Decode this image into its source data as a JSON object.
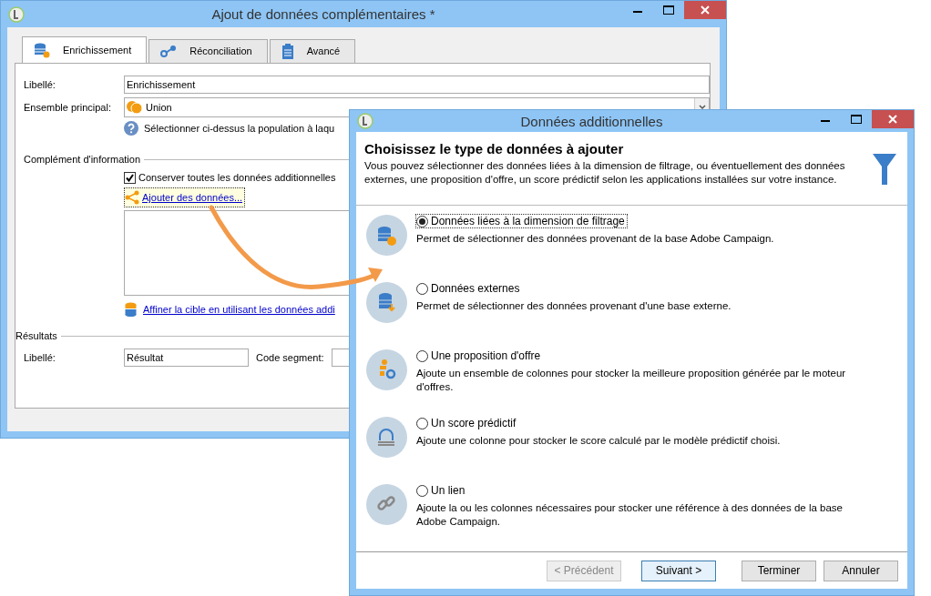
{
  "main_window": {
    "title": "Ajout de données complémentaires *",
    "tabs": [
      {
        "kind": "enrichment",
        "label": "Enrichissement",
        "selected": true
      },
      {
        "kind": "reconciliation",
        "label": "Réconciliation",
        "selected": false
      },
      {
        "kind": "advanced",
        "label": "Avancé",
        "selected": false
      }
    ],
    "label_field": {
      "label": "Libellé:",
      "value": "Enrichissement"
    },
    "main_set": {
      "label": "Ensemble principal:",
      "value": "Union"
    },
    "help_text": "Sélectionner ci-dessus la population à laqu",
    "complement": {
      "title": "Complément d'information",
      "keep_all": {
        "label": "Conserver toutes les données additionnelles",
        "checked": true
      },
      "add_link": "Ajouter des données...",
      "refine_link": "Affiner la cible en utilisant les données addi"
    },
    "results": {
      "title": "Résultats",
      "label_field": {
        "label": "Libellé:",
        "value": "Résultat"
      },
      "segment_code": {
        "label": "Code segment:"
      }
    }
  },
  "dialog": {
    "title": "Données additionnelles",
    "heading": "Choisissez le type de données à ajouter",
    "description": "Vous pouvez sélectionner des données liées à la dimension de filtrage, ou éventuellement des données externes, une proposition d'offre, un score prédictif selon les applications installées sur votre instance.",
    "options": [
      {
        "kind": "filter-data",
        "label": "Données liées à la dimension de filtrage",
        "description": "Permet de sélectionner des données provenant de la base Adobe Campaign.",
        "selected": true
      },
      {
        "kind": "external",
        "label": "Données externes",
        "description": "Permet de sélectionner des données provenant d'une base externe.",
        "selected": false
      },
      {
        "kind": "offer",
        "label": "Une proposition d'offre",
        "description": "Ajoute un ensemble de colonnes pour stocker la meilleure proposition générée par le moteur d'offres.",
        "selected": false
      },
      {
        "kind": "score",
        "label": "Un score prédictif",
        "description": "Ajoute une colonne pour stocker le score calculé par le modèle prédictif choisi.",
        "selected": false
      },
      {
        "kind": "link",
        "label": "Un lien",
        "description": "Ajoute la ou les colonnes nécessaires pour stocker une référence à des données de la base Adobe Campaign.",
        "selected": false
      }
    ],
    "buttons": [
      {
        "label": "< Précédent",
        "disabled": true,
        "default": false
      },
      {
        "label": "Suivant >",
        "disabled": false,
        "default": true
      },
      {
        "label": "Terminer",
        "disabled": false,
        "default": false
      },
      {
        "label": "Annuler",
        "disabled": false,
        "default": false
      }
    ]
  }
}
